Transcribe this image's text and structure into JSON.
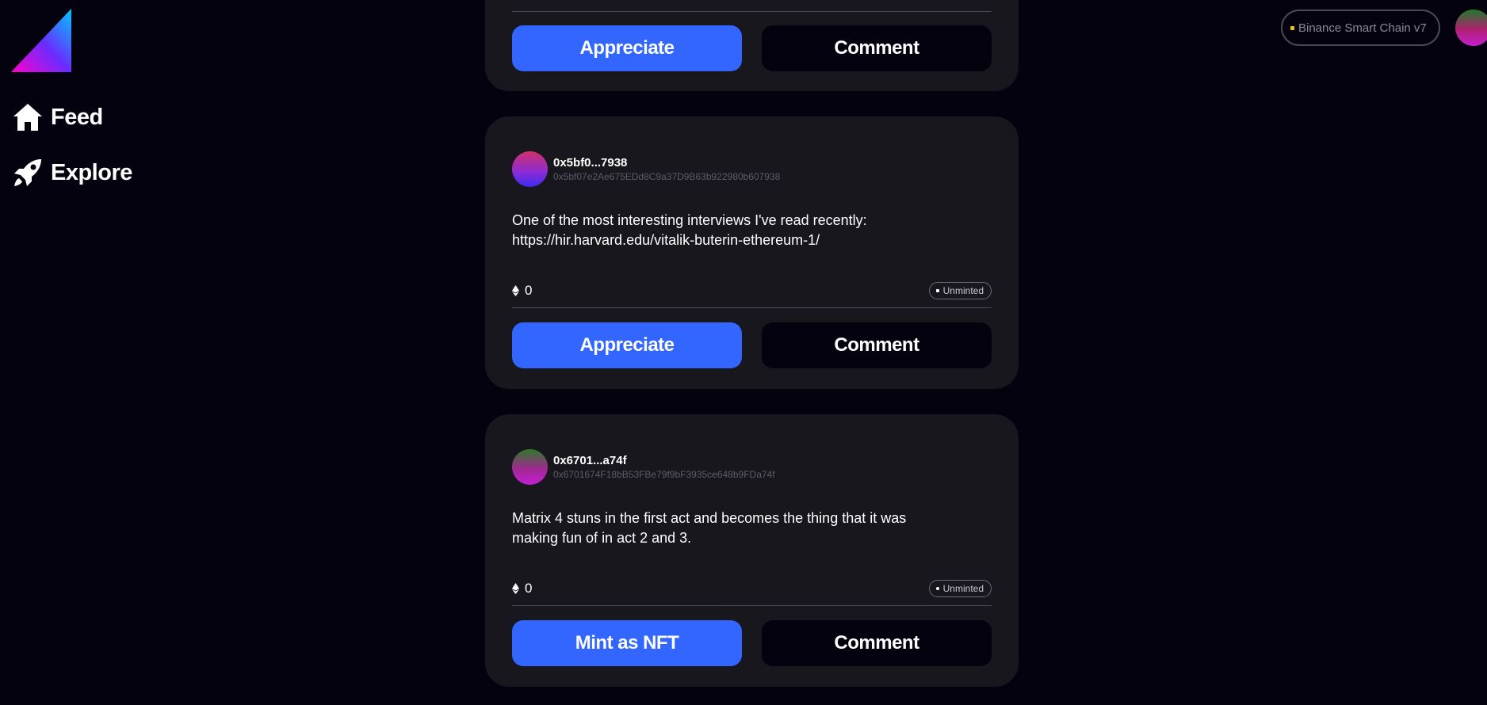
{
  "sidebar": {
    "items": [
      {
        "label": "Feed",
        "icon": "home-icon"
      },
      {
        "label": "Explore",
        "icon": "rocket-icon"
      }
    ]
  },
  "header": {
    "network": "Binance Smart Chain v7"
  },
  "colors": {
    "background": "#04020f",
    "card": "#18171e",
    "primary_button": "#3366ff",
    "secondary_button": "#04020f"
  },
  "feed": {
    "posts": [
      {
        "primary_action": "Appreciate",
        "secondary_action": "Comment"
      },
      {
        "author_short": "0x5bf0...7938",
        "author_full": "0x5bf07e2Ae675EDd8C9a37D9B63b922980b607938",
        "text_line1": "One of the most interesting interviews I've read recently:",
        "text_line2": "https://hir.harvard.edu/vitalik-buterin-ethereum-1/",
        "eth_count": "0",
        "status": "Unminted",
        "primary_action": "Appreciate",
        "secondary_action": "Comment"
      },
      {
        "author_short": "0x6701...a74f",
        "author_full": "0x6701674F18bB53FBe79f9bF3935ce648b9FDa74f",
        "text_line1": "Matrix 4 stuns in the first act and becomes the thing that it was",
        "text_line2": "making fun of in act 2 and 3.",
        "eth_count": "0",
        "status": "Unminted",
        "primary_action": "Mint as NFT",
        "secondary_action": "Comment"
      }
    ]
  }
}
